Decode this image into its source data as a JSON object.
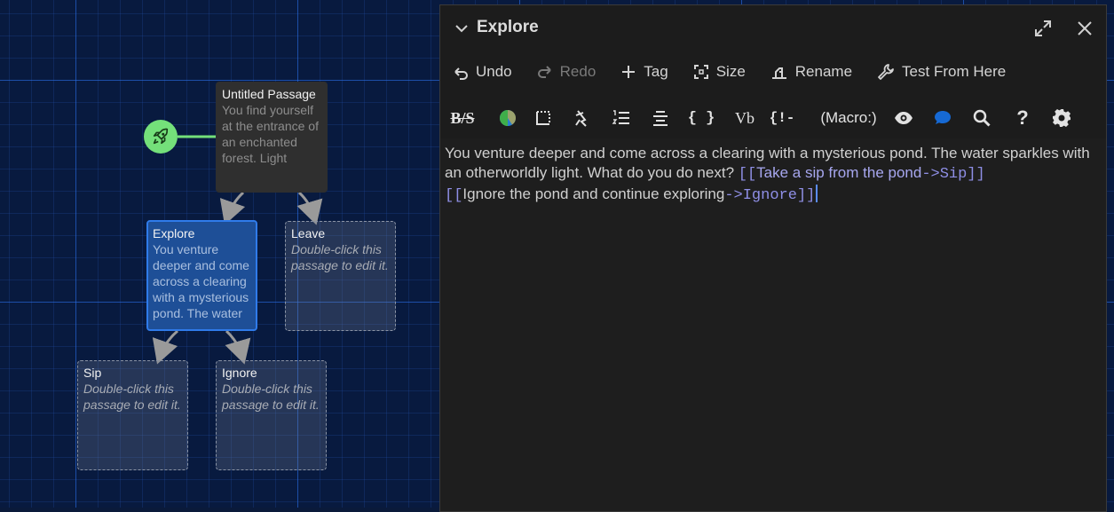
{
  "story_map": {
    "passages": [
      {
        "name": "passage-untitled",
        "title": "Untitled Passage",
        "excerpt": "You find yourself at the entrance of an enchanted forest. Light"
      },
      {
        "name": "passage-explore",
        "title": "Explore",
        "excerpt": "You venture deeper and come across a clearing with a mysterious pond. The water"
      },
      {
        "name": "passage-leave",
        "title": "Leave",
        "excerpt": "Double-click this passage to edit it."
      },
      {
        "name": "passage-sip",
        "title": "Sip",
        "excerpt": "Double-click this passage to edit it."
      },
      {
        "name": "passage-ignore",
        "title": "Ignore",
        "excerpt": "Double-click this passage to edit it."
      }
    ],
    "start_icon": "rocket-icon",
    "colors": {
      "grid_background": "#081a3f",
      "selected_passage": "#1e4f97",
      "start_marker": "#74e07a"
    }
  },
  "dialog": {
    "title": "Explore",
    "toolbar": {
      "undo": "Undo",
      "redo": "Redo",
      "tag": "Tag",
      "size": "Size",
      "rename": "Rename",
      "test_from_here": "Test From Here"
    },
    "format_toolbar": {
      "bs_label": "B/S",
      "braces": "{ }",
      "vb": "Vb",
      "macro": "(Macro:)",
      "help": "?",
      "collapse": "{!-"
    },
    "body": {
      "text": "You venture deeper and come across a clearing with a mysterious pond. The water sparkles with an otherworldly light. What do you do next? ",
      "link1_open": "[[",
      "link1_text": "Take a sip from the pond",
      "link1_arrow": "->Sip",
      "link1_close": "]]",
      "link2_open": "[[",
      "link2_text": "Ignore the pond and continue exploring",
      "link2_arrow": "->Ignore",
      "link2_close": "]]"
    }
  }
}
